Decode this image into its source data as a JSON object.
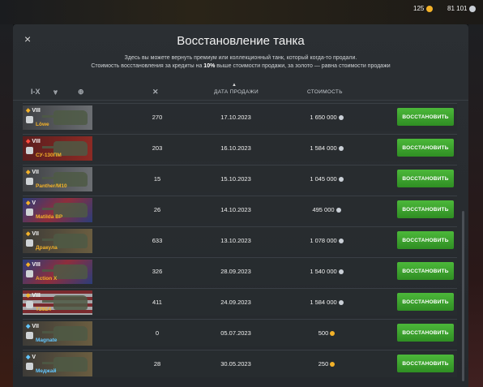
{
  "currency": {
    "gold": "125",
    "silver": "81 101"
  },
  "modal": {
    "close_label": "×",
    "title": "Восстановление танка",
    "subtitle_1": "Здесь вы можете вернуть премиум или коллекционный танк, который когда-то продали.",
    "subtitle_2_a": "Стоимость восстановления за кредиты на ",
    "subtitle_2_b": "10%",
    "subtitle_2_c": " выше стоимости продажи, за золото — равна стоимости продажи"
  },
  "header": {
    "filter_tier": "I-X",
    "date_label": "ДАТА ПРОДАЖИ",
    "cost_label": "СТОИМОСТЬ",
    "sort_arrow": "▲"
  },
  "button_label": "ВОССТАНОВИТЬ",
  "rows": [
    {
      "tier": "VIII",
      "name": "Löwe",
      "battles": "270",
      "date": "17.10.2023",
      "cost": "1 650 000",
      "currency": "silver",
      "flag": "de",
      "name_color": "gold",
      "mark": "gold"
    },
    {
      "tier": "VIII",
      "name": "СУ-130ПМ",
      "battles": "203",
      "date": "16.10.2023",
      "cost": "1 584 000",
      "currency": "silver",
      "flag": "red",
      "name_color": "gold",
      "mark": "red"
    },
    {
      "tier": "VII",
      "name": "Panther/M10",
      "battles": "15",
      "date": "15.10.2023",
      "cost": "1 045 000",
      "currency": "silver",
      "flag": "de",
      "name_color": "gold",
      "mark": "gold"
    },
    {
      "tier": "V",
      "name": "Matilda BP",
      "battles": "26",
      "date": "14.10.2023",
      "cost": "495 000",
      "currency": "silver",
      "flag": "gb",
      "name_color": "gold",
      "mark": "gold"
    },
    {
      "tier": "VII",
      "name": "Дракула",
      "battles": "633",
      "date": "13.10.2023",
      "cost": "1 078 000",
      "currency": "silver",
      "flag": "ussr",
      "name_color": "gold",
      "mark": "gold"
    },
    {
      "tier": "VIII",
      "name": "Action X",
      "battles": "326",
      "date": "28.09.2023",
      "cost": "1 540 000",
      "currency": "silver",
      "flag": "gb",
      "name_color": "gold",
      "mark": "gold"
    },
    {
      "tier": "VIII",
      "name": "T26E4",
      "battles": "411",
      "date": "24.09.2023",
      "cost": "1 584 000",
      "currency": "silver",
      "flag": "us",
      "name_color": "gold",
      "mark": "gold"
    },
    {
      "tier": "VII",
      "name": "Magnate",
      "battles": "0",
      "date": "05.07.2023",
      "cost": "500",
      "currency": "gold",
      "flag": "ussr",
      "name_color": "blue",
      "mark": "blue"
    },
    {
      "tier": "V",
      "name": "Меджай",
      "battles": "28",
      "date": "30.05.2023",
      "cost": "250",
      "currency": "gold",
      "flag": "ussr",
      "name_color": "blue",
      "mark": "blue"
    }
  ]
}
